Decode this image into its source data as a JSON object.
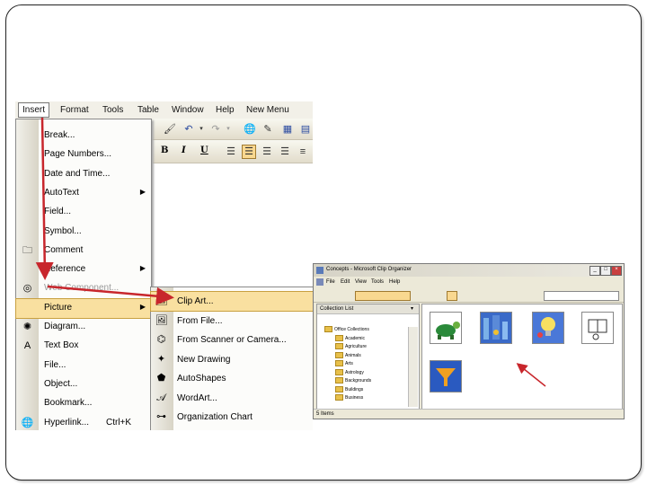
{
  "menubar": [
    "Insert",
    "Format",
    "Tools",
    "Table",
    "Window",
    "Help",
    "New Menu"
  ],
  "insert_menu": [
    {
      "label": "Break...",
      "icon": ""
    },
    {
      "label": "Page Numbers...",
      "icon": ""
    },
    {
      "label": "Date and Time...",
      "icon": ""
    },
    {
      "label": "AutoText",
      "icon": "",
      "submenu": true
    },
    {
      "label": "Field...",
      "icon": ""
    },
    {
      "label": "Symbol...",
      "icon": ""
    },
    {
      "label": "Comment",
      "icon": "comment-icon"
    },
    {
      "label": "Reference",
      "icon": "",
      "submenu": true
    },
    {
      "label": "Web Component...",
      "icon": "web-component-icon",
      "disabled": true
    },
    {
      "label": "Picture",
      "icon": "",
      "submenu": true,
      "highlighted": true
    },
    {
      "label": "Diagram...",
      "icon": "diagram-icon"
    },
    {
      "label": "Text Box",
      "icon": "text-box-icon"
    },
    {
      "label": "File...",
      "icon": ""
    },
    {
      "label": "Object...",
      "icon": ""
    },
    {
      "label": "Bookmark...",
      "icon": ""
    },
    {
      "label": "Hyperlink...",
      "icon": "hyperlink-icon",
      "shortcut": "Ctrl+K"
    }
  ],
  "picture_submenu": [
    {
      "label": "Clip Art...",
      "icon": "clip-art-icon",
      "highlighted": true
    },
    {
      "label": "From File...",
      "icon": "from-file-icon"
    },
    {
      "label": "From Scanner or Camera...",
      "icon": "scanner-icon"
    },
    {
      "label": "New Drawing",
      "icon": "new-drawing-icon"
    },
    {
      "label": "AutoShapes",
      "icon": "autoshapes-icon"
    },
    {
      "label": "WordArt...",
      "icon": "wordart-icon"
    },
    {
      "label": "Organization Chart",
      "icon": "org-chart-icon"
    }
  ],
  "format_toolbar": [
    "B",
    "I",
    "U"
  ],
  "clip_organizer": {
    "title": "Concepts - Microsoft Clip Organizer",
    "menu": [
      "File",
      "Edit",
      "View",
      "Tools",
      "Help"
    ],
    "pane_title": "Collection List",
    "tree": [
      "Office Collections",
      "Academic",
      "Agriculture",
      "Animals",
      "Arts",
      "Astrology",
      "Backgrounds",
      "Buildings",
      "Business"
    ],
    "status": "5 Items"
  },
  "colors": {
    "arrow": "#c8262c",
    "highlight": "#f9e0a0"
  }
}
